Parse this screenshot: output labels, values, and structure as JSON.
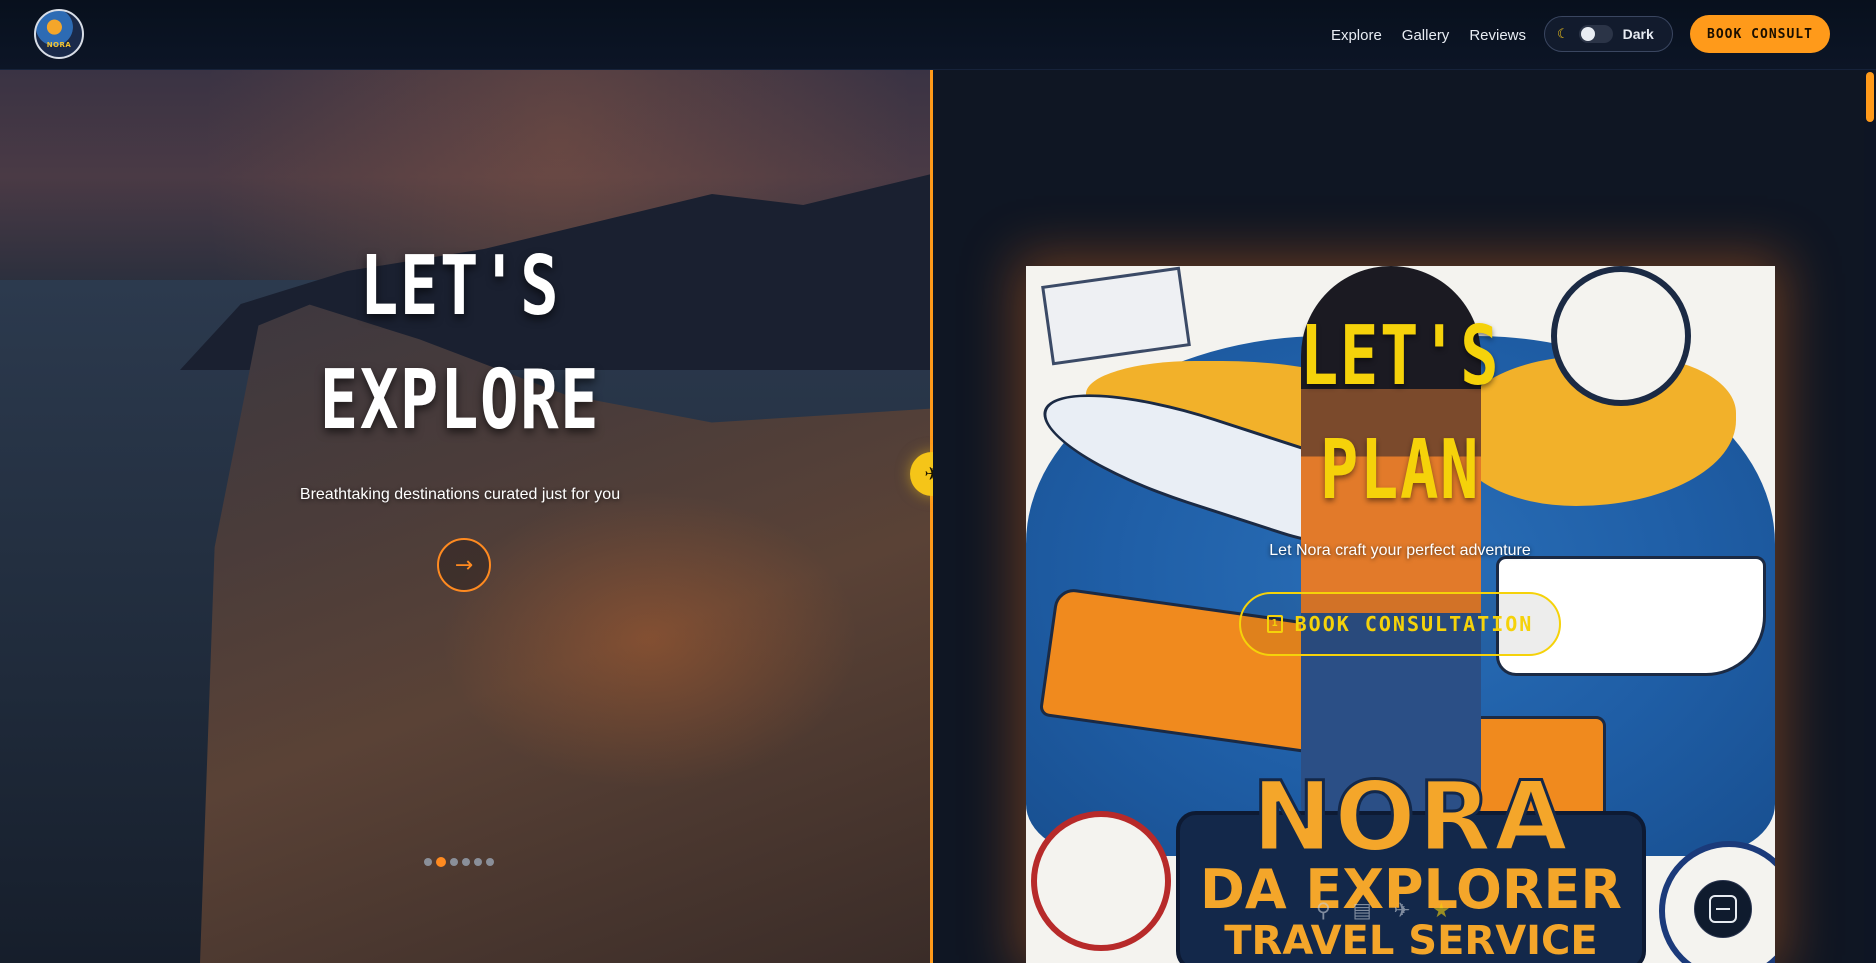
{
  "navbar": {
    "logo_text": "NORA",
    "links": [
      "Explore",
      "Gallery",
      "Reviews"
    ],
    "theme_toggle": {
      "label": "Dark",
      "icon": "moon-icon"
    },
    "cta_label": "BOOK CONSULT"
  },
  "left": {
    "title_line1": "LET'S",
    "title_line2": "EXPLORE",
    "subtitle": "Breathtaking destinations curated just for you",
    "next_icon": "arrow-right-icon",
    "slide_count": 6,
    "active_slide": 2
  },
  "divider": {
    "icon": "airplane-icon"
  },
  "right": {
    "title_line1": "LET'S",
    "title_line2": "PLAN",
    "subtitle": "Let Nora craft your perfect adventure",
    "cta_label": "BOOK CONSULTATION",
    "cta_icon": "calendar-icon",
    "poster": {
      "brand_name": "NORA",
      "brand_line2": "DA EXPLORER",
      "brand_line3": "TRAVEL SERVICE"
    }
  },
  "colors": {
    "accent": "#ff9a1a",
    "yellow": "#f5d20a",
    "bg": "#0f1623"
  }
}
